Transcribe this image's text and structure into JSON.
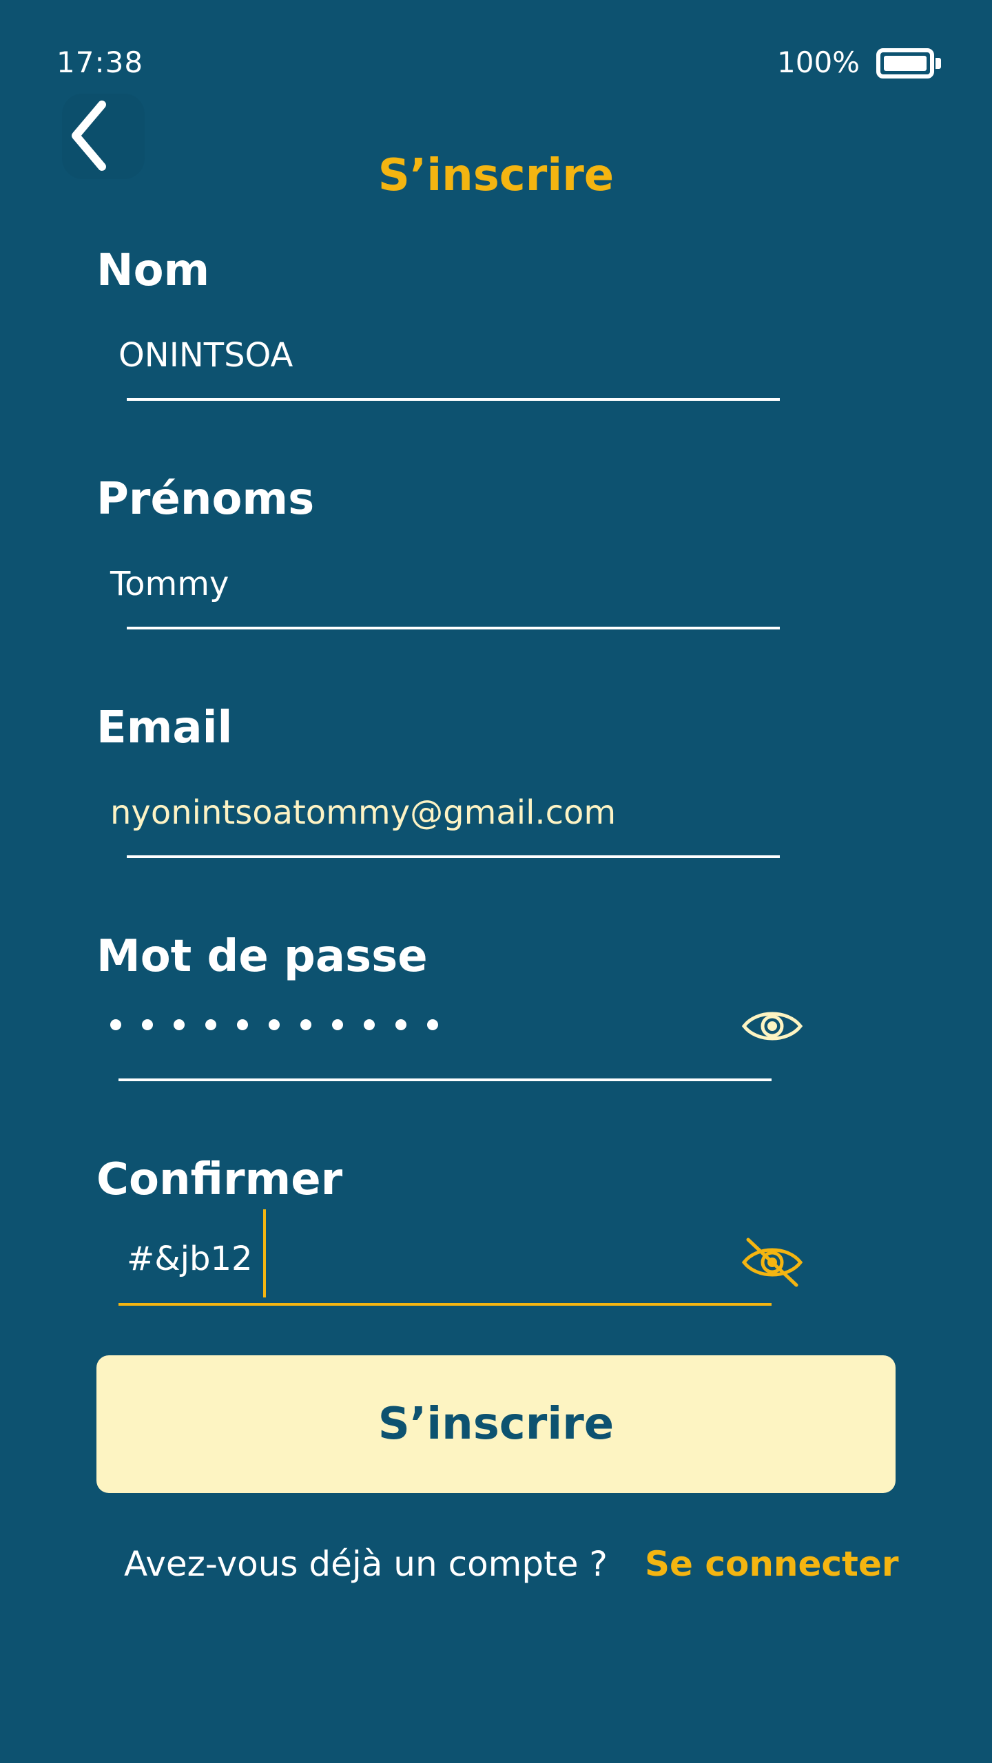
{
  "status_bar": {
    "time": "17:38",
    "battery_text": "100%",
    "battery_level": 1.0
  },
  "header": {
    "back_icon": "chevron-left-icon",
    "title": "S’inscrire"
  },
  "form": {
    "nom": {
      "label": "Nom",
      "value": "ONINTSOA"
    },
    "prenoms": {
      "label": "Prénoms",
      "value": "Tommy"
    },
    "email": {
      "label": "Email",
      "value": "nyonintsoatommy@gmail.com"
    },
    "password": {
      "label": "Mot de passe",
      "masked_length": 11,
      "toggle_icon": "eye-icon"
    },
    "confirm": {
      "label": "Confirmer",
      "value": "#&jb12",
      "toggle_icon": "eye-off-icon"
    }
  },
  "submit": {
    "label": "S’inscrire"
  },
  "footer": {
    "prompt": "Avez-vous déjà un compte ?",
    "link": "Se connecter"
  },
  "colors": {
    "background": "#0d5270",
    "accent": "#f4b511",
    "button_bg": "#fdf4c2",
    "text": "#ffffff"
  }
}
